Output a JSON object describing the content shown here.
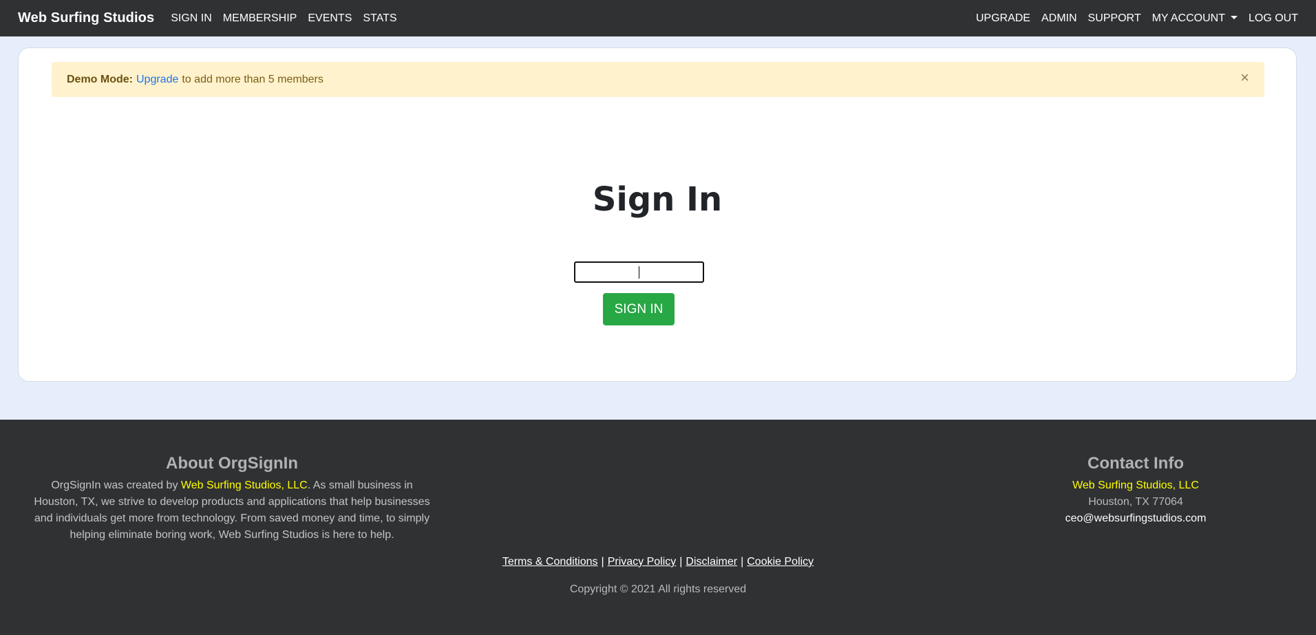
{
  "navbar": {
    "brand": "Web Surfing Studios",
    "left_links": [
      "SIGN IN",
      "MEMBERSHIP",
      "EVENTS",
      "STATS"
    ],
    "right_links": [
      "UPGRADE",
      "ADMIN",
      "SUPPORT",
      "MY ACCOUNT",
      "LOG OUT"
    ]
  },
  "alert": {
    "label": "Demo Mode:",
    "link": "Upgrade",
    "text": "to add more than 5 members",
    "close": "×",
    "close_icon": "close-icon"
  },
  "signin": {
    "title": "Sign In",
    "input_value": "",
    "button": "SIGN IN",
    "button_color": "#28a745"
  },
  "footer": {
    "about_heading": "About OrgSignIn",
    "about_prefix": "OrgSignIn was created by",
    "about_link": "Web Surfing Studios, LLC",
    "about_suffix": ". As small business in Houston, TX, we strive to develop products and applications that help businesses and individuals get more from technology. From saved money and time, to simply helping eliminate boring work, Web Surfing Studios is here to help.",
    "contact_heading": "Contact Info",
    "contact_company": "Web Surfing Studios, LLC",
    "contact_city": "Houston, TX 77064",
    "contact_email": "ceo@websurfingstudios.com",
    "links": [
      "Terms & Conditions",
      "Privacy Policy",
      "Disclaimer",
      "Cookie Policy"
    ],
    "separator": "|",
    "copyright": "Copyright © 2021 All rights reserved",
    "link_color": "#ffff00"
  },
  "colors": {
    "navbar_bg": "#2f3133",
    "page_bg": "#e6edfb",
    "alert_bg": "#fff2cc"
  }
}
